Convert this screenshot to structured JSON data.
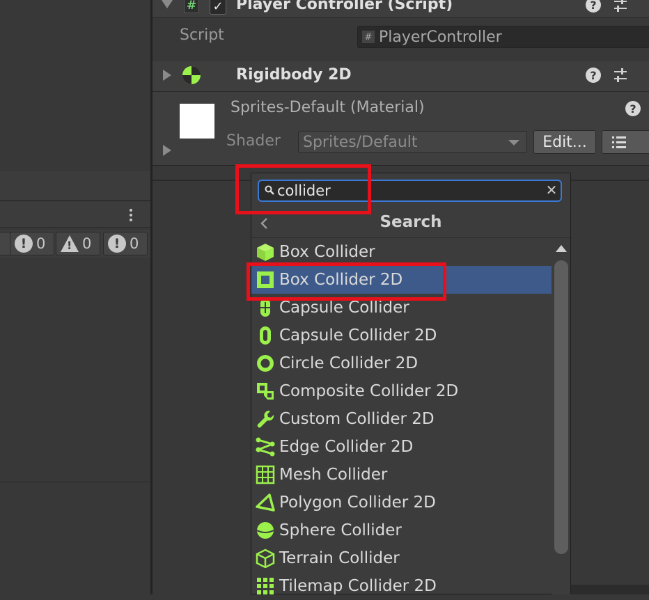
{
  "player_controller": {
    "title": "Player Controller (Script)",
    "script_label": "Script",
    "script_value": "PlayerController"
  },
  "rigidbody": {
    "title": "Rigidbody 2D"
  },
  "material": {
    "title": "Sprites-Default (Material)",
    "shader_label": "Shader",
    "shader_value": "Sprites/Default",
    "edit_label": "Edit..."
  },
  "console": {
    "log_count": "0",
    "warning_count": "0",
    "error_count": "0"
  },
  "add_component": {
    "search_value": "collider",
    "nav_title": "Search",
    "items": [
      {
        "label": "Box Collider",
        "icon": "cube-icon"
      },
      {
        "label": "Box Collider 2D",
        "icon": "box-2d-icon",
        "selected": true
      },
      {
        "label": "Capsule Collider",
        "icon": "capsule-icon"
      },
      {
        "label": "Capsule Collider 2D",
        "icon": "capsule-2d-icon"
      },
      {
        "label": "Circle Collider 2D",
        "icon": "circle-2d-icon"
      },
      {
        "label": "Composite Collider 2D",
        "icon": "composite-2d-icon"
      },
      {
        "label": "Custom Collider 2D",
        "icon": "wrench-icon"
      },
      {
        "label": "Edge Collider 2D",
        "icon": "edge-2d-icon"
      },
      {
        "label": "Mesh Collider",
        "icon": "mesh-grid-icon"
      },
      {
        "label": "Polygon Collider 2D",
        "icon": "polygon-2d-icon"
      },
      {
        "label": "Sphere Collider",
        "icon": "sphere-icon"
      },
      {
        "label": "Terrain Collider",
        "icon": "terrain-icon"
      },
      {
        "label": "Tilemap Collider 2D",
        "icon": "tilemap-icon"
      }
    ]
  },
  "colors": {
    "accent_green": "#9bf04b",
    "selection": "#3d5a8a",
    "highlight_red": "#e8101a",
    "search_focus": "#3a7ad6"
  }
}
